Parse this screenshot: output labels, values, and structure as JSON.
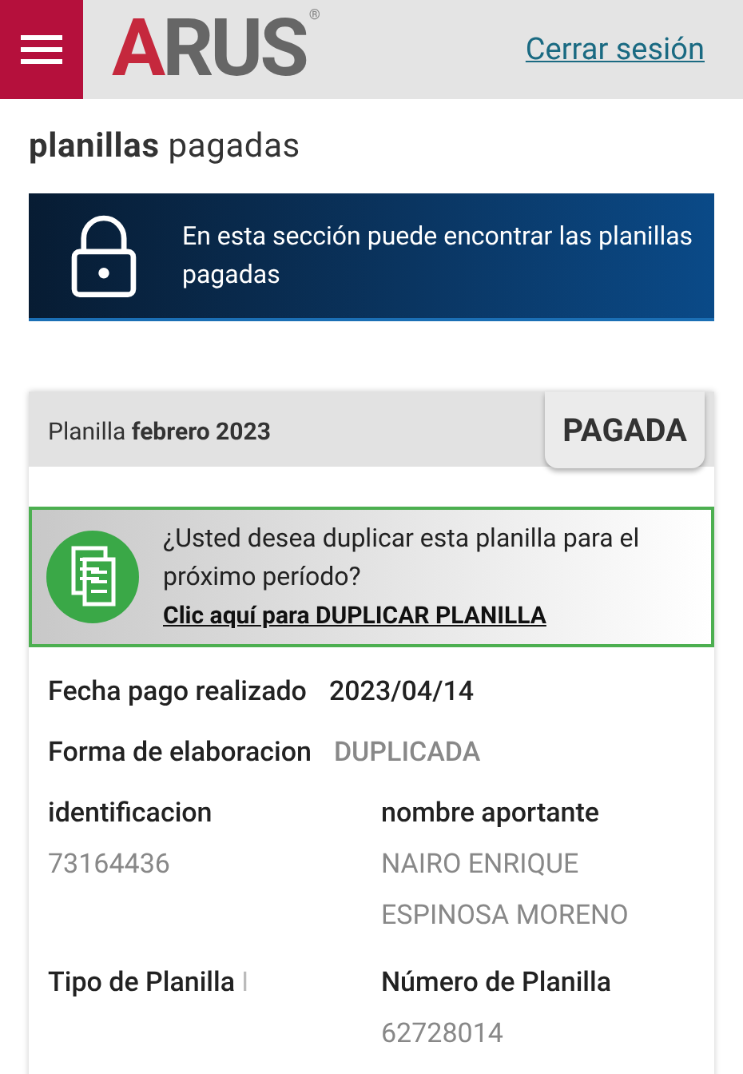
{
  "header": {
    "logo": "ARUS",
    "logo_mark": "®",
    "logout": "Cerrar sesión"
  },
  "page_title": "**planillas** pagadas",
  "banner": {
    "text": "En esta sección puede encontrar las planillas pagadas"
  },
  "card": {
    "title": "Planilla **febrero 2023**",
    "status": "PAGADA",
    "duplicate": {
      "question": "¿Usted desea duplicar esta planilla para el próximo período?",
      "link": "Clic aquí para DUPLICAR PLANILLA"
    },
    "summary": [
      {
        "label": "Fecha pago realizado",
        "value": "2023/04/14",
        "kind": "strong"
      },
      {
        "label": "Forma de elaboracion",
        "value": "DUPLICADA",
        "kind": "muted"
      }
    ],
    "details": [
      {
        "label": "identificacion",
        "value": "73164436",
        "kind": "stacked"
      },
      {
        "label": "nombre aportante",
        "value": "NAIRO ENRIQUE ESPINOSA MORENO",
        "kind": "stacked"
      },
      {
        "label": "Tipo de Planilla",
        "value": "I",
        "kind": "inline"
      },
      {
        "label": "Número de Planilla",
        "value": "62728014",
        "kind": "stacked"
      }
    ]
  }
}
